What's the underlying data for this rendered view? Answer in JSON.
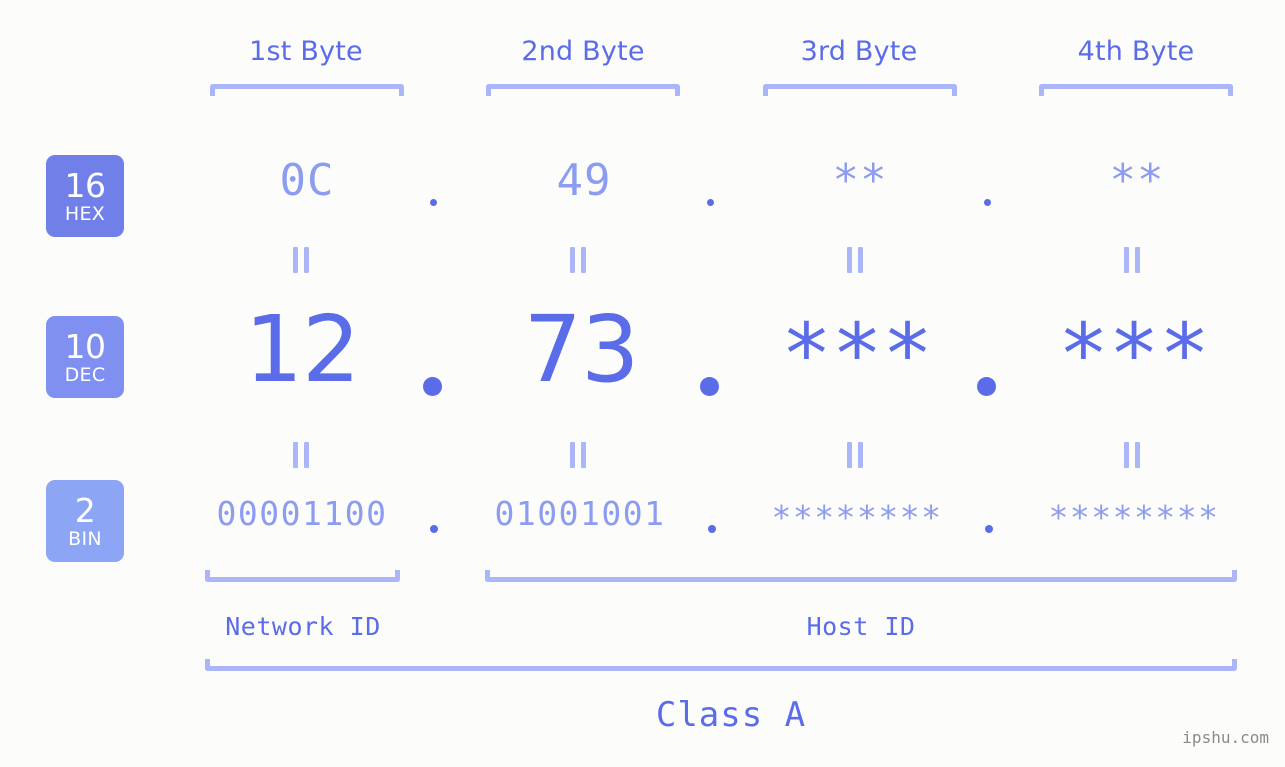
{
  "background_color": "#fcfdfa",
  "accent_color": "#5b6ce8",
  "muted_color": "#8c9cf0",
  "bracket_color": "#aab6f7",
  "headers": [
    {
      "label": "1st Byte"
    },
    {
      "label": "2nd Byte"
    },
    {
      "label": "3rd Byte"
    },
    {
      "label": "4th Byte"
    }
  ],
  "bases": [
    {
      "number": "16",
      "name": "HEX",
      "color": "#7080e8"
    },
    {
      "number": "10",
      "name": "DEC",
      "color": "#8090f0"
    },
    {
      "number": "2",
      "name": "BIN",
      "color": "#8ca5f5"
    }
  ],
  "rows": {
    "hex": {
      "values": [
        "0C",
        "49",
        "**",
        "**"
      ]
    },
    "dec": {
      "values": [
        "12",
        "73",
        "***",
        "***"
      ]
    },
    "bin": {
      "values": [
        "00001100",
        "01001001",
        "********",
        "********"
      ]
    }
  },
  "separator": ".",
  "equals_symbol": "=",
  "segments": [
    {
      "label": "Network ID"
    },
    {
      "label": "Host ID"
    }
  ],
  "class_label": "Class A",
  "watermark": "ipshu.com"
}
